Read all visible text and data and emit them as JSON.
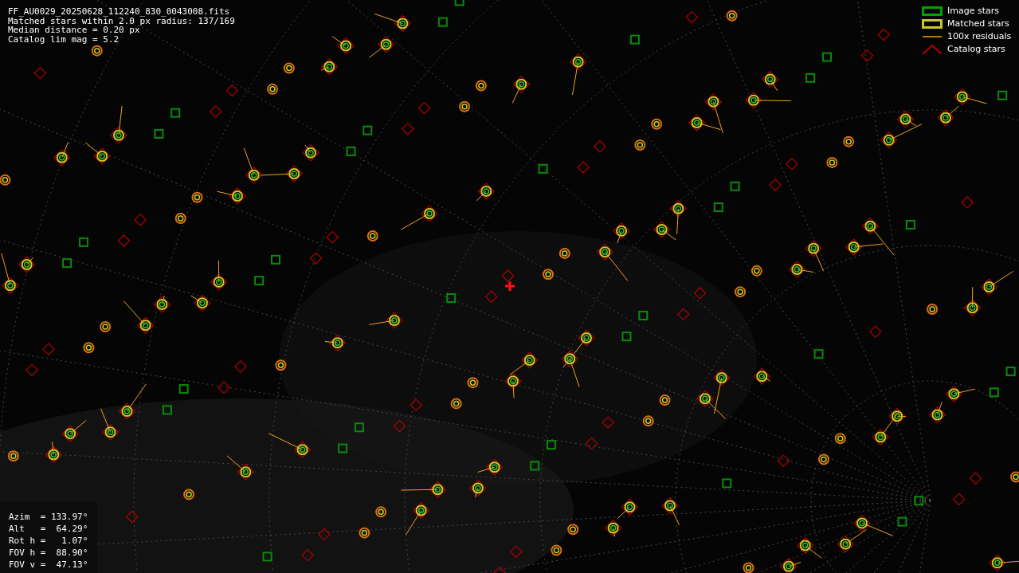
{
  "info_lines": [
    "FF_AU0029_20250628_112240_830_0043008.fits",
    "Matched stars within 2.0 px radius: 137/169",
    "Median distance = 0.20 px",
    "Catalog lim mag = 5.2"
  ],
  "legend": [
    {
      "kind": "image",
      "label": "Image stars"
    },
    {
      "kind": "matched",
      "label": "Matched stars"
    },
    {
      "kind": "residual",
      "label": "100x residuals"
    },
    {
      "kind": "catalog",
      "label": "Catalog stars"
    }
  ],
  "pointing": [
    "Azim  = 133.97°",
    "Alt   =  64.29°",
    "Rot h =   1.07°",
    "FOV h =  88.90°",
    "FOV v =  47.13°"
  ]
}
